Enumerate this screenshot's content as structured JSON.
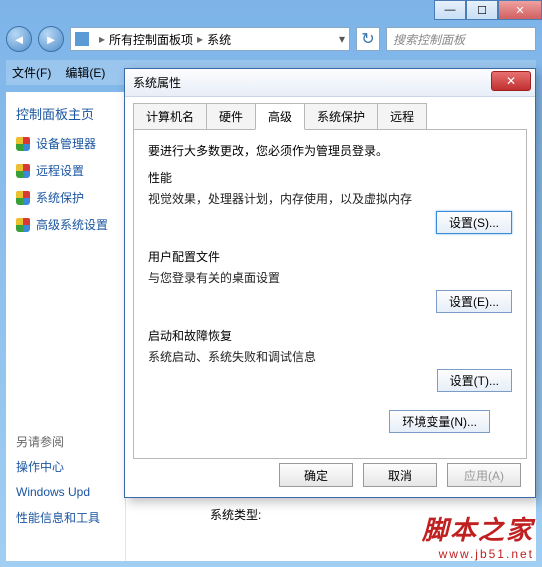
{
  "outer_window": {
    "min": "—",
    "max": "☐",
    "close": "✕"
  },
  "addr": {
    "back": "◄",
    "forward": "►",
    "crumb1": "所有控制面板项",
    "crumb2": "系统",
    "sep": "▸",
    "dropdown": "▾",
    "refresh": "↻",
    "search_placeholder": "搜索控制面板"
  },
  "menu": {
    "file": "文件(F)",
    "edit": "编辑(E)"
  },
  "sidebar": {
    "home": "控制面板主页",
    "items": [
      {
        "label": "设备管理器"
      },
      {
        "label": "远程设置"
      },
      {
        "label": "系统保护"
      },
      {
        "label": "高级系统设置"
      }
    ],
    "see_also_title": "另请参阅",
    "see_also": [
      {
        "label": "操作中心"
      },
      {
        "label": "Windows Upd"
      },
      {
        "label": "性能信息和工具"
      }
    ]
  },
  "main": {
    "systype_label": "系统类型:"
  },
  "dialog": {
    "title": "系统属性",
    "close": "✕",
    "tabs": [
      "计算机名",
      "硬件",
      "高级",
      "系统保护",
      "远程"
    ],
    "note": "要进行大多数更改，您必须作为管理员登录。",
    "groups": [
      {
        "title": "性能",
        "desc": "视觉效果，处理器计划，内存使用，以及虚拟内存",
        "btn": "设置(S)..."
      },
      {
        "title": "用户配置文件",
        "desc": "与您登录有关的桌面设置",
        "btn": "设置(E)..."
      },
      {
        "title": "启动和故障恢复",
        "desc": "系统启动、系统失败和调试信息",
        "btn": "设置(T)..."
      }
    ],
    "env_btn": "环境变量(N)...",
    "ok": "确定",
    "cancel": "取消",
    "apply": "应用(A)"
  },
  "watermark": {
    "text": "脚本之家",
    "url": "www.jb51.net"
  }
}
